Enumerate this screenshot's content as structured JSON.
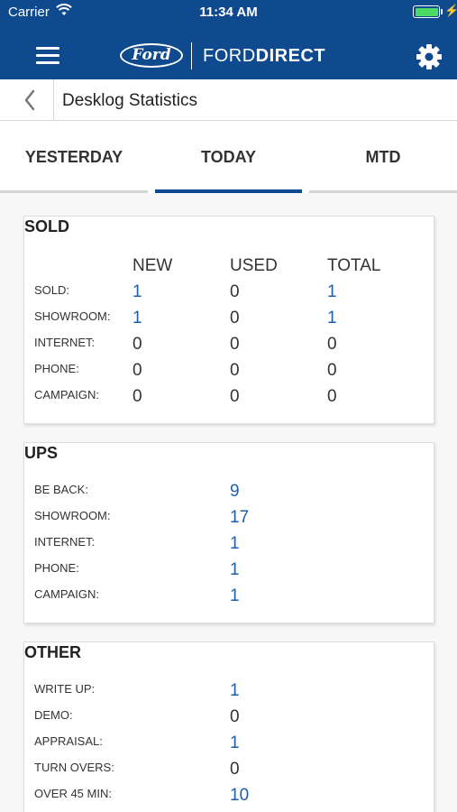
{
  "status": {
    "carrier": "Carrier",
    "time": "11:34 AM"
  },
  "nav": {
    "logo_ford": "Ford",
    "logo_brand_light": "FORD",
    "logo_brand_bold": "DIRECT"
  },
  "header": {
    "title": "Desklog Statistics"
  },
  "tabs": [
    {
      "label": "YESTERDAY"
    },
    {
      "label": "TODAY"
    },
    {
      "label": "MTD"
    }
  ],
  "sold": {
    "title": "SOLD",
    "columns": [
      "NEW",
      "USED",
      "TOTAL"
    ],
    "rows": [
      {
        "label": "SOLD:",
        "values": [
          "1",
          "0",
          "1"
        ]
      },
      {
        "label": "SHOWROOM:",
        "values": [
          "1",
          "0",
          "1"
        ]
      },
      {
        "label": "INTERNET:",
        "values": [
          "0",
          "0",
          "0"
        ]
      },
      {
        "label": "PHONE:",
        "values": [
          "0",
          "0",
          "0"
        ]
      },
      {
        "label": "CAMPAIGN:",
        "values": [
          "0",
          "0",
          "0"
        ]
      }
    ]
  },
  "ups": {
    "title": "UPS",
    "rows": [
      {
        "label": "BE BACK:",
        "value": "9"
      },
      {
        "label": "SHOWROOM:",
        "value": "17"
      },
      {
        "label": "INTERNET:",
        "value": "1"
      },
      {
        "label": "PHONE:",
        "value": "1"
      },
      {
        "label": "CAMPAIGN:",
        "value": "1"
      }
    ]
  },
  "other": {
    "title": "OTHER",
    "rows": [
      {
        "label": "WRITE UP:",
        "value": "1"
      },
      {
        "label": "DEMO:",
        "value": "0"
      },
      {
        "label": "APPRAISAL:",
        "value": "1"
      },
      {
        "label": "TURN OVERS:",
        "value": "0"
      },
      {
        "label": "OVER 45 MIN:",
        "value": "10"
      }
    ]
  },
  "colors": {
    "brand": "#0f4a8e",
    "link_value": "#1e5fa8",
    "battery": "#4cd964"
  }
}
